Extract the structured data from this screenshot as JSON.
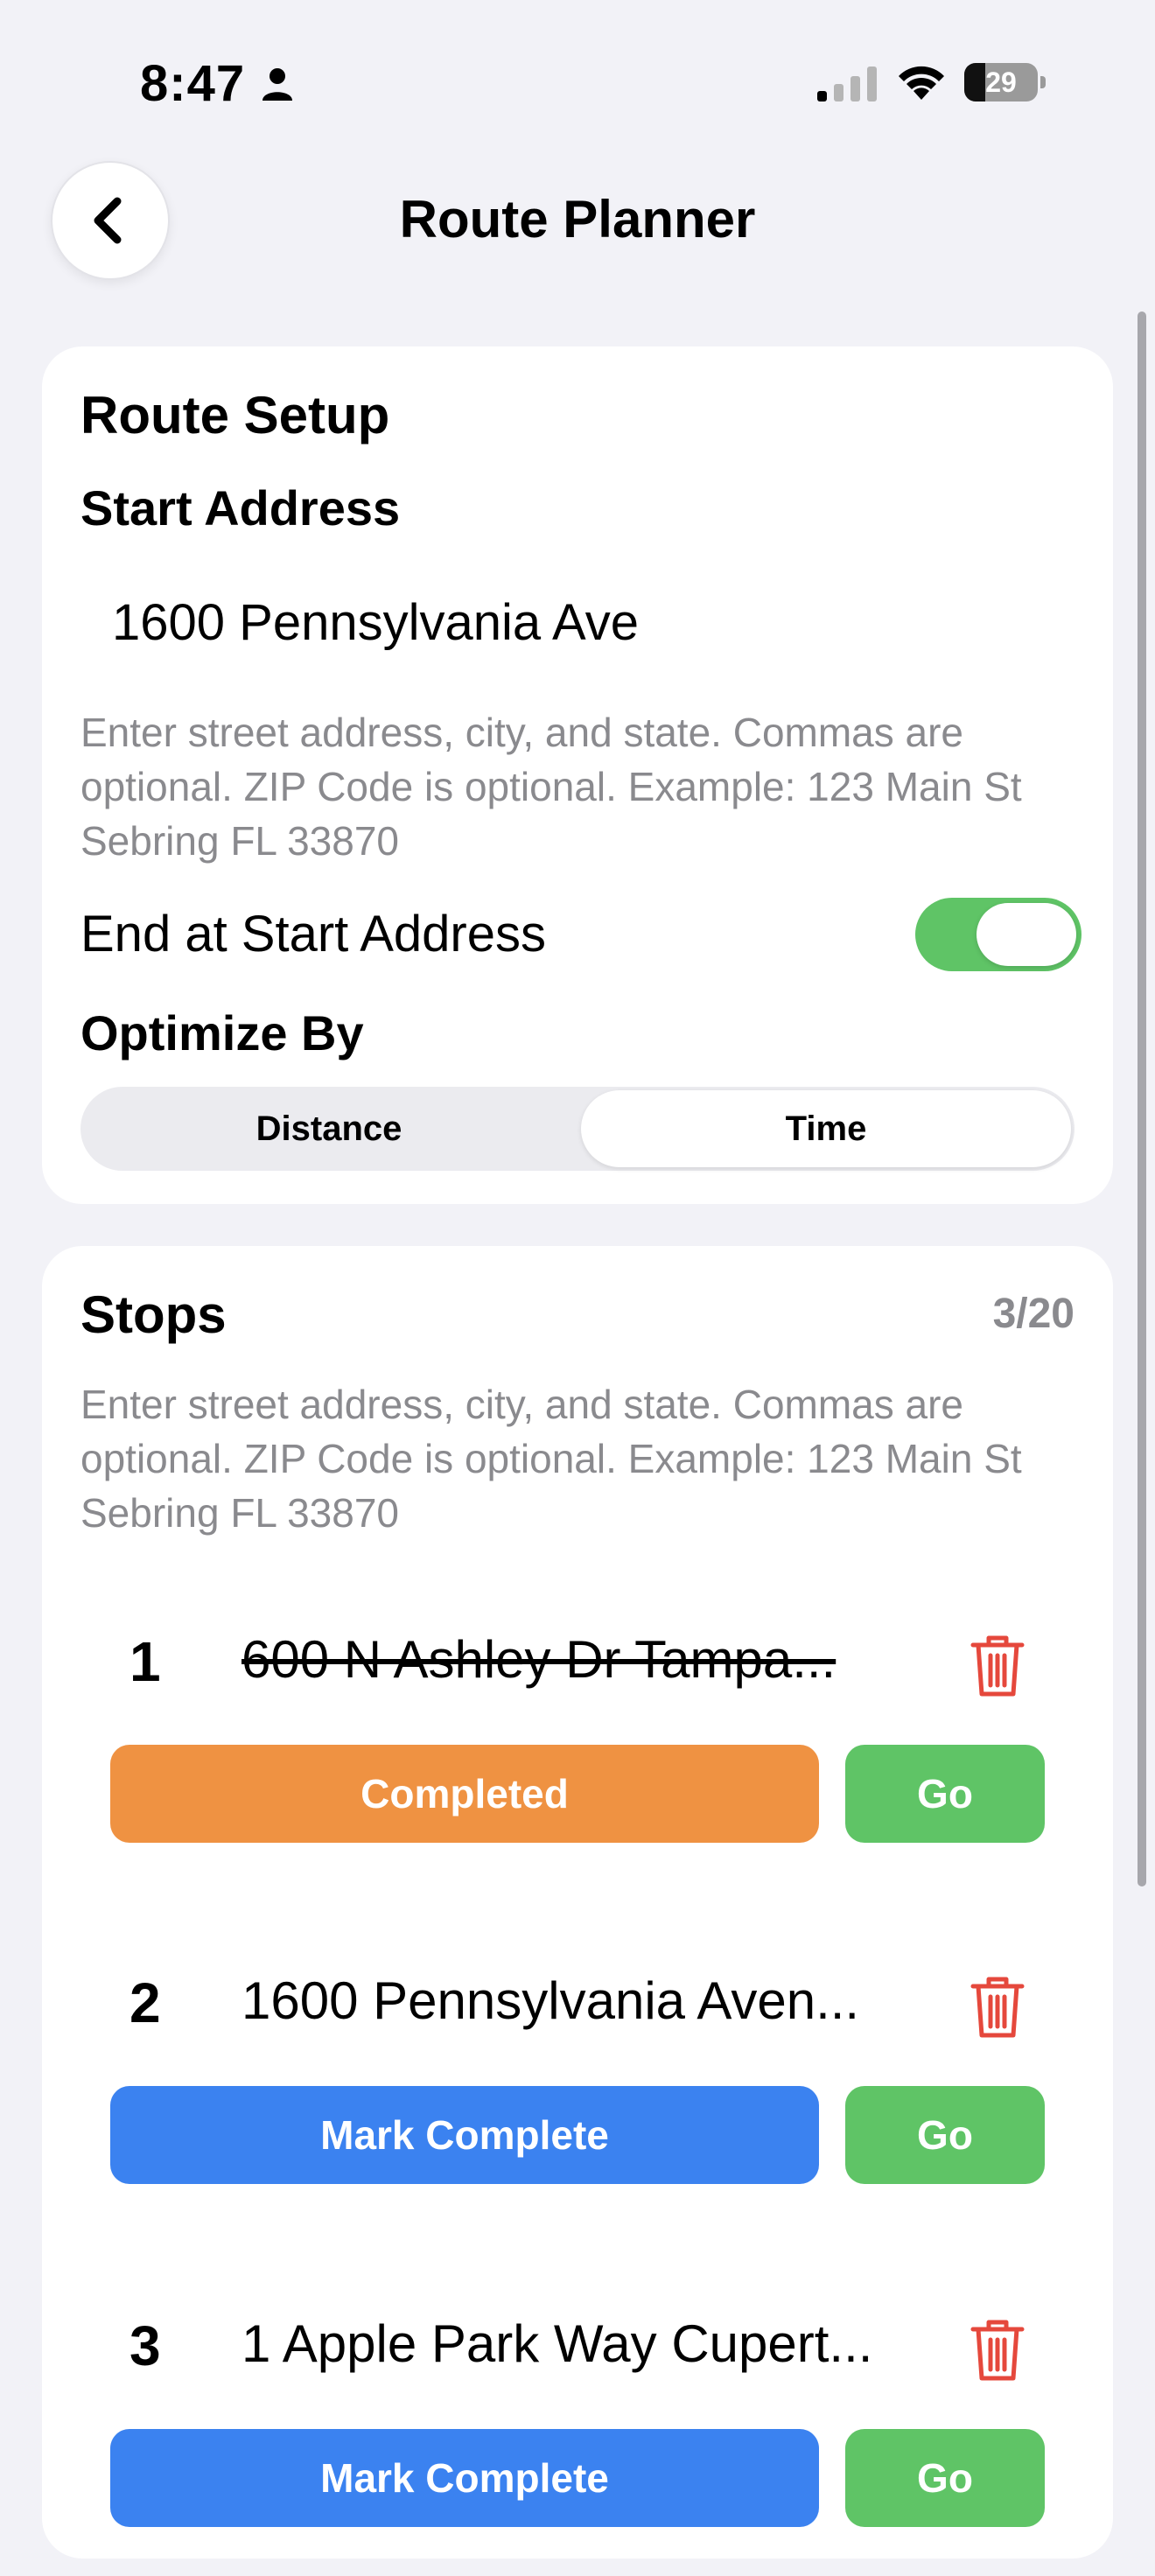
{
  "status_bar": {
    "time": "8:47",
    "battery_percent": "29",
    "battery_level": 0.29,
    "icons": [
      "person-icon",
      "signal-icon",
      "wifi-icon",
      "battery-icon"
    ]
  },
  "nav": {
    "title": "Route Planner",
    "back_icon": "chevron-left-icon"
  },
  "route_setup": {
    "title": "Route Setup",
    "start_label": "Start Address",
    "start_value": "1600 Pennsylvania Ave",
    "hint": "Enter street address, city, and state. Commas are optional. ZIP Code is optional. Example: 123 Main St Sebring FL 33870",
    "end_at_start_label": "End at Start Address",
    "end_at_start_on": true,
    "optimize_label": "Optimize By",
    "optimize_options": [
      "Distance",
      "Time"
    ],
    "optimize_selected": "Time"
  },
  "stops": {
    "title": "Stops",
    "count": "3/20",
    "hint": "Enter street address, city, and state. Commas are optional. ZIP Code is optional. Example: 123 Main St Sebring FL 33870",
    "items": [
      {
        "number": "1",
        "address": "600 N Ashley Dr Tampa...",
        "completed": true,
        "primary_label": "Completed",
        "go_label": "Go"
      },
      {
        "number": "2",
        "address": "1600 Pennsylvania Aven...",
        "completed": false,
        "primary_label": "Mark Complete",
        "go_label": "Go"
      },
      {
        "number": "3",
        "address": "1 Apple Park Way Cupert...",
        "completed": false,
        "primary_label": "Mark Complete",
        "go_label": "Go"
      }
    ]
  },
  "colors": {
    "completed": "#EF9242",
    "mark_complete": "#3B82F0",
    "go": "#5FC466",
    "trash": "#E5483C",
    "toggle_on": "#5FC466"
  }
}
